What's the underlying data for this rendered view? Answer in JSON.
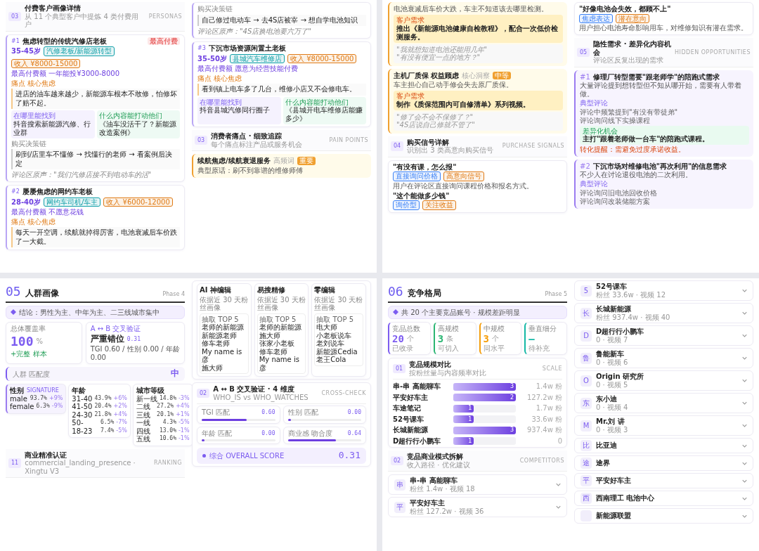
{
  "pages": [
    {
      "columns": [
        [
          {
            "kind": "section",
            "num": "03",
            "title": "付费客户画像详情",
            "subtitle": "从 11 个典型客户中提炼 4 类付费用户",
            "tag": "PERSONAS"
          },
          {
            "kind": "persona",
            "num": "#1",
            "title": "焦虑转型的传统汽修店老板",
            "badge": "最高付费",
            "age": "35-45岁",
            "tags": [
              {
                "text": "汽修老板/新能源转型",
                "color": "#0f9fa8"
              },
              {
                "text": "收入 ¥8000-15000",
                "color": "#e07b16"
              }
            ],
            "note": "最高付费额 一年能投¥3000-8000",
            "pain_label": "痛点 核心焦虑",
            "pain": "进店的油车越来越少，新能源车根本不敢修，怕修坏了赔不起。",
            "boxes": [
              {
                "label": "在哪里能找到",
                "text": "抖音搜索新能源汽修、行业群"
              },
              {
                "label": "什么内容能打动他们",
                "text": "《油车没活干了？新能源改造案例》"
              }
            ],
            "decision_label": "购买决策链",
            "decision": "刷到/店里车不懂修 → 找懂行的老师 → 看案例后决定",
            "comment": "评论区原声：\"我们汽修店接不到电动车的活\""
          },
          {
            "kind": "persona",
            "num": "#2",
            "title": "屡屡焦虑的网约车老板",
            "age": "28-40岁",
            "tags": [
              {
                "text": "网约车司机/车主",
                "color": "#0f9fa8"
              },
              {
                "text": "收入 ¥6000-12000",
                "color": "#e07b16"
              }
            ],
            "note": "最高付费额 不愿意花钱",
            "pain_label": "痛点 核心焦虑",
            "pain": "每天一开空调，续航就掉得厉害，电池衰减后车价跌了一大截。"
          }
        ],
        [
          {
            "kind": "tail",
            "decision_label": "购买决策链",
            "decision": "自己修过电动车 → 去4S店被宰 → 想自学电池知识",
            "comment": "评论区原声：\"4S店换电池要六万了\""
          },
          {
            "kind": "persona",
            "num": "#3",
            "title": "下沉市场资源闲置土老板",
            "age": "35-50岁",
            "tags": [
              {
                "text": "县城汽车维修店",
                "color": "#0f9fa8"
              },
              {
                "text": "收入 ¥8000-15000",
                "color": "#e07b16"
              }
            ],
            "note": "最高付费额 愿意为经营技能付费",
            "pain_label": "痛点 核心焦虑",
            "pain": "看到镇上电车多了几台，维修小店又不会修电车。",
            "boxes": [
              {
                "label": "在哪里能找到",
                "text": "抖音县城汽修同行圈子"
              },
              {
                "label": "什么内容能打动他们",
                "text": "《县城开电车维修店能赚多少》"
              }
            ]
          },
          {
            "kind": "section",
            "num": "03",
            "title": "消费者痛点 · 细致追踪",
            "subtitle": "每个痛点标注产品或服务机会",
            "tag": "PAIN POINTS"
          },
          {
            "kind": "callout",
            "title": "续航焦虑/续航衰退服务",
            "tag": "高频词",
            "badge": "重要",
            "lines": [
              "典型原话：刷不到靠谱的维修师傅"
            ]
          }
        ]
      ]
    },
    {
      "columns": [
        [
          {
            "kind": "callout",
            "lines": [
              "电池衰减后车价大跌，车主不知道该去哪里检测。"
            ],
            "highlight": {
              "label": "客户需求",
              "text": "推出《新能源电池健康自检教程》，配合一次低价检测服务。"
            },
            "quotes": [
              "\"我就想知道电池还能用几年\"",
              "\"有没有便宜一点的地方？\""
            ]
          },
          {
            "kind": "callout",
            "title": "主机厂质保 权益顾虑",
            "tag": "核心洞察",
            "badge": "中等",
            "lines": [
              "车主担心自己动手修会失去原厂质保。"
            ],
            "highlight": {
              "label": "客户需求",
              "text": "制作《质保范围内可自修清单》系列视频。"
            },
            "quotes": [
              "\"修了会不会不保修了？\"",
              "\"4S店说自己修就不管了\""
            ]
          },
          {
            "kind": "section",
            "num": "04",
            "title": "购买信号详解",
            "subtitle": "识别出 3 类高意向购买信号",
            "tag": "PURCHASE SIGNALS"
          },
          {
            "kind": "signals",
            "items": [
              {
                "quote": "\"有没有课，怎么报\"",
                "tags": [
                  {
                    "text": "直接询问价格",
                    "color": "#3b82f6"
                  },
                  {
                    "text": "高意向信号",
                    "color": "#e07b16"
                  }
                ],
                "text": "用户在评论区直接询问课程价格和报名方式。"
              },
              {
                "quote": "\"这个能做多少钱\"",
                "tags": [
                  {
                    "text": "询价型",
                    "color": "#3b82f6"
                  },
                  {
                    "text": "关注收益",
                    "color": "#e07b16"
                  }
                ]
              }
            ]
          }
        ],
        [
          {
            "kind": "signals",
            "items": [
              {
                "quote": "\"好像电池会失效，都顾不上\"",
                "tags": [
                  {
                    "text": "焦虑表达",
                    "color": "#3b82f6"
                  },
                  {
                    "text": "潜在意向",
                    "color": "#e07b16"
                  }
                ],
                "text": "用户担心电池寿命影响用车，对维修知识有潜在需求。"
              }
            ]
          },
          {
            "kind": "section",
            "num": "05",
            "title": "隐性需求 · 差异化内容机会",
            "subtitle": "评论区反复出现的需求",
            "tag": "HIDDEN OPPORTUNITIES"
          },
          {
            "kind": "insight",
            "num": "#1",
            "title": "修理厂转型需要\"跟老师学\"的陪跑式需求",
            "text": "大量评论提到想转型但不知从哪开始，需要有人带着做。",
            "list_label": "典型评论",
            "list": [
              "评论中频繁提到\"有没有带徒弟\"",
              "评论询问线下实操课程"
            ],
            "green_label": "差异化机会",
            "green": "主打\"跟着老师做一台车\"的陪跑式课程。",
            "warn": "转化提醒：需避免过度承诺收益。"
          },
          {
            "kind": "insight",
            "num": "#2",
            "title": "下沉市场对维修电池\"再次利用\"的信息需求",
            "text": "不少人在讨论退役电池的二次利用。",
            "list_label": "典型评论",
            "list": [
              "评论询问旧电池回收价格",
              "评论询问改装储能方案"
            ]
          }
        ]
      ]
    },
    {
      "columns": [
        [
          {
            "kind": "phase",
            "num": "05",
            "title": "人群画像",
            "phase": "Phase 4"
          },
          {
            "kind": "banner",
            "text": "结论：男性为主、中年为主、二三线城市集中"
          },
          {
            "kind": "summary",
            "count": {
              "label": "总体覆盖率",
              "value": "100",
              "unit": "%",
              "note": "+完整 样本"
            },
            "verdict": {
              "label": "A ↔ B 交叉验证",
              "title": "严重错位",
              "score": "0.31",
              "text": "TGI 0.60 / 性别 0.00 / 年龄 0.00"
            }
          },
          {
            "kind": "match",
            "label": "人群 匹配度",
            "value": "中"
          },
          {
            "kind": "tables",
            "tables": [
              {
                "title": "性别",
                "tag": "SIGNATURE",
                "selected": true,
                "rows": [
                  {
                    "label": "male",
                    "pct": "93.7%",
                    "delta": "+9%"
                  },
                  {
                    "label": "female",
                    "pct": "6.3%",
                    "delta": "-9%"
                  }
                ]
              },
              {
                "title": "年龄",
                "selected": false,
                "rows": [
                  {
                    "label": "31-40",
                    "pct": "43.9%",
                    "delta": "+6%"
                  },
                  {
                    "label": "41-50",
                    "pct": "20.4%",
                    "delta": "+2%"
                  },
                  {
                    "label": "24-30",
                    "pct": "21.8%",
                    "delta": "+4%"
                  },
                  {
                    "label": "50-",
                    "pct": "6.5%",
                    "delta": "-7%"
                  },
                  {
                    "label": "18-23",
                    "pct": "7.4%",
                    "delta": "-5%"
                  }
                ]
              },
              {
                "title": "城市等级",
                "selected": false,
                "rows": [
                  {
                    "label": "新一线",
                    "pct": "14.8%",
                    "delta": "-3%"
                  },
                  {
                    "label": "二线",
                    "pct": "27.2%",
                    "delta": "+4%"
                  },
                  {
                    "label": "三线",
                    "pct": "20.1%",
                    "delta": "+1%"
                  },
                  {
                    "label": "一线",
                    "pct": "4.3%",
                    "delta": "-5%"
                  },
                  {
                    "label": "四线",
                    "pct": "13.0%",
                    "delta": "-1%"
                  },
                  {
                    "label": "五线",
                    "pct": "10.6%",
                    "delta": "-1%"
                  }
                ]
              }
            ]
          },
          {
            "kind": "section",
            "num": "11",
            "title": "商业精准认证",
            "subtitle": "commercial_landing_presence · Xingtu V3",
            "tag": "RANKING"
          }
        ],
        [
          {
            "kind": "sources",
            "cards": [
              {
                "title": "AI 神编辑",
                "text": "依据近 30 天粉丝画像",
                "list_label": "抽取 TOP 5",
                "list": [
                  "老师的新能源",
                  "新能源老师",
                  "修车老师",
                  "My name is 彦",
                  "施大师"
                ]
              },
              {
                "title": "易搜精修",
                "text": "依据近 30 天粉丝画像",
                "list_label": "抽取 TOP 5",
                "list": [
                  "老师的新能源",
                  "施大师",
                  "张家小老板",
                  "修车老师",
                  "My name is 彦"
                ]
              },
              {
                "title": "零编辑",
                "text": "依据近 30 天粉丝画像",
                "list_label": "抽取 TOP 5",
                "list": [
                  "电大师",
                  "小老板说车",
                  "老刘说车",
                  "新能源Cedia",
                  "老王Cola"
                ]
              }
            ]
          },
          {
            "kind": "cross",
            "num": "02",
            "title": "A ↔ B 交叉验证 · 4 维度",
            "subtitle": "WHO_IS vs WHO_WATCHES",
            "tag": "CROSS-CHECK",
            "meters": [
              {
                "label": "TGI 匹配",
                "value": "0.60",
                "level": 0.6
              },
              {
                "label": "性别 匹配",
                "value": "0.00",
                "level": 0
              },
              {
                "label": "年龄 匹配",
                "value": "0.00",
                "level": 0
              },
              {
                "label": "商业感 吻合度",
                "value": "0.64",
                "level": 0.64
              }
            ],
            "overall_label": "综合 OVERALL SCORE",
            "overall": "0.31"
          }
        ]
      ]
    },
    {
      "columns": [
        [
          {
            "kind": "phase",
            "num": "06",
            "title": "竞争格局",
            "phase": "Phase 5"
          },
          {
            "kind": "banner",
            "text": "共 20 个主要竞品账号 · 规模差距明显"
          },
          {
            "kind": "stats",
            "items": [
              {
                "label": "竞品总数",
                "value": "20",
                "unit": "个",
                "note": "已收录",
                "color": "#7c5cf0"
              },
              {
                "label": "高规模",
                "value": "3",
                "unit": "条",
                "note": "可切入",
                "color": "#2bb673"
              },
              {
                "label": "中规模",
                "value": "3",
                "unit": "个",
                "note": "同水平",
                "color": "#f59e0b"
              },
              {
                "label": "垂直细分",
                "value": "—",
                "note": "待补充",
                "color": "#14b8a6"
              }
            ]
          },
          {
            "kind": "bars",
            "num": "01",
            "title": "竞品规模对比",
            "subtitle": "按粉丝量与内容频率对比",
            "tag": "SCALE",
            "rows": [
              {
                "name": "串-串 高能聊车",
                "count": "3",
                "level": 1,
                "value": "1.4w 粉"
              },
              {
                "name": "平安好车主",
                "count": "2",
                "level": 1,
                "value": "127.2w 粉"
              },
              {
                "name": "车途笔记",
                "count": "1",
                "level": 0.33,
                "value": "1.7w 粉"
              },
              {
                "name": "52号课车",
                "count": "1",
                "level": 0.33,
                "value": "33.6w 粉"
              },
              {
                "name": "长城新能源",
                "count": "3",
                "level": 1,
                "value": "937.4w 粉"
              },
              {
                "name": "D超行行小鹏车",
                "count": "1",
                "level": 0.33,
                "value": "0"
              }
            ]
          },
          {
            "kind": "section",
            "num": "02",
            "title": "竞品商业模式拆解",
            "subtitle": "收入路径 · 优化建议",
            "tag": "COMPETITORS"
          },
          {
            "kind": "accordion",
            "items": [
              {
                "icon": "串",
                "name": "串-串 高能聊车",
                "sub": "粉丝 1.4w · 视频 18"
              },
              {
                "icon": "平",
                "name": "平安好车主",
                "sub": "粉丝 127.2w · 视频 36"
              }
            ]
          }
        ],
        [
          {
            "kind": "accordion",
            "items": [
              {
                "icon": "5",
                "name": "52号课车",
                "sub": "粉丝 33.6w · 视频 12"
              },
              {
                "icon": "长",
                "name": "长城新能源",
                "sub": "粉丝 937.4w · 视频 40"
              },
              {
                "icon": "D",
                "name": "D超行行小鹏车",
                "sub": "0 · 视频 7"
              },
              {
                "icon": "鲁",
                "name": "鲁能新车",
                "sub": "0 · 视频 6"
              },
              {
                "icon": "O",
                "name": "Origin 研究所",
                "sub": "0 · 视频 5"
              },
              {
                "icon": "东",
                "name": "东小迪",
                "sub": "0 · 视频 4"
              },
              {
                "icon": "M",
                "name": "Mr.刘 讲",
                "sub": "0 · 视频 3"
              },
              {
                "icon": "比",
                "name": "比亚迪"
              },
              {
                "icon": "途",
                "name": "途界"
              },
              {
                "icon": "平",
                "name": "平安好车主"
              },
              {
                "icon": "西",
                "name": "西南理工 电池中心"
              },
              {
                "name": "新能源联盟"
              }
            ]
          }
        ]
      ]
    }
  ]
}
